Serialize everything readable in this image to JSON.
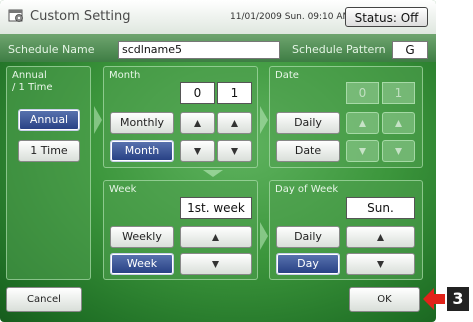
{
  "header": {
    "title": "Custom Setting",
    "datetime": "11/01/2009 Sun. 09:10 AM",
    "status_button": "Status: Off"
  },
  "schedule": {
    "name_label": "Schedule Name",
    "name_value": "scdlname5",
    "pattern_label": "Schedule Pattern",
    "pattern_value": "G"
  },
  "annual_panel": {
    "title_line1": "Annual",
    "title_line2": "/ 1 Time",
    "annual_button": "Annual",
    "onetime_button": "1 Time",
    "selected": "Annual"
  },
  "month_panel": {
    "title": "Month",
    "value_tens": "0",
    "value_ones": "1",
    "monthly_button": "Monthly",
    "month_button": "Month",
    "selected": "Month"
  },
  "date_panel": {
    "title": "Date",
    "value_tens": "0",
    "value_ones": "1",
    "daily_button": "Daily",
    "date_button": "Date",
    "enabled": false
  },
  "week_panel": {
    "title": "Week",
    "value": "1st. week",
    "weekly_button": "Weekly",
    "week_button": "Week",
    "selected": "Week"
  },
  "dayofweek_panel": {
    "title": "Day of Week",
    "value": "Sun.",
    "daily_button": "Daily",
    "day_button": "Day",
    "selected": "Day"
  },
  "footer": {
    "cancel_button": "Cancel",
    "ok_button": "OK",
    "callout_number": "3"
  },
  "colors": {
    "background_green": "#3c963c",
    "selected_blue": "#263f83",
    "callout_red": "#e2231a"
  }
}
